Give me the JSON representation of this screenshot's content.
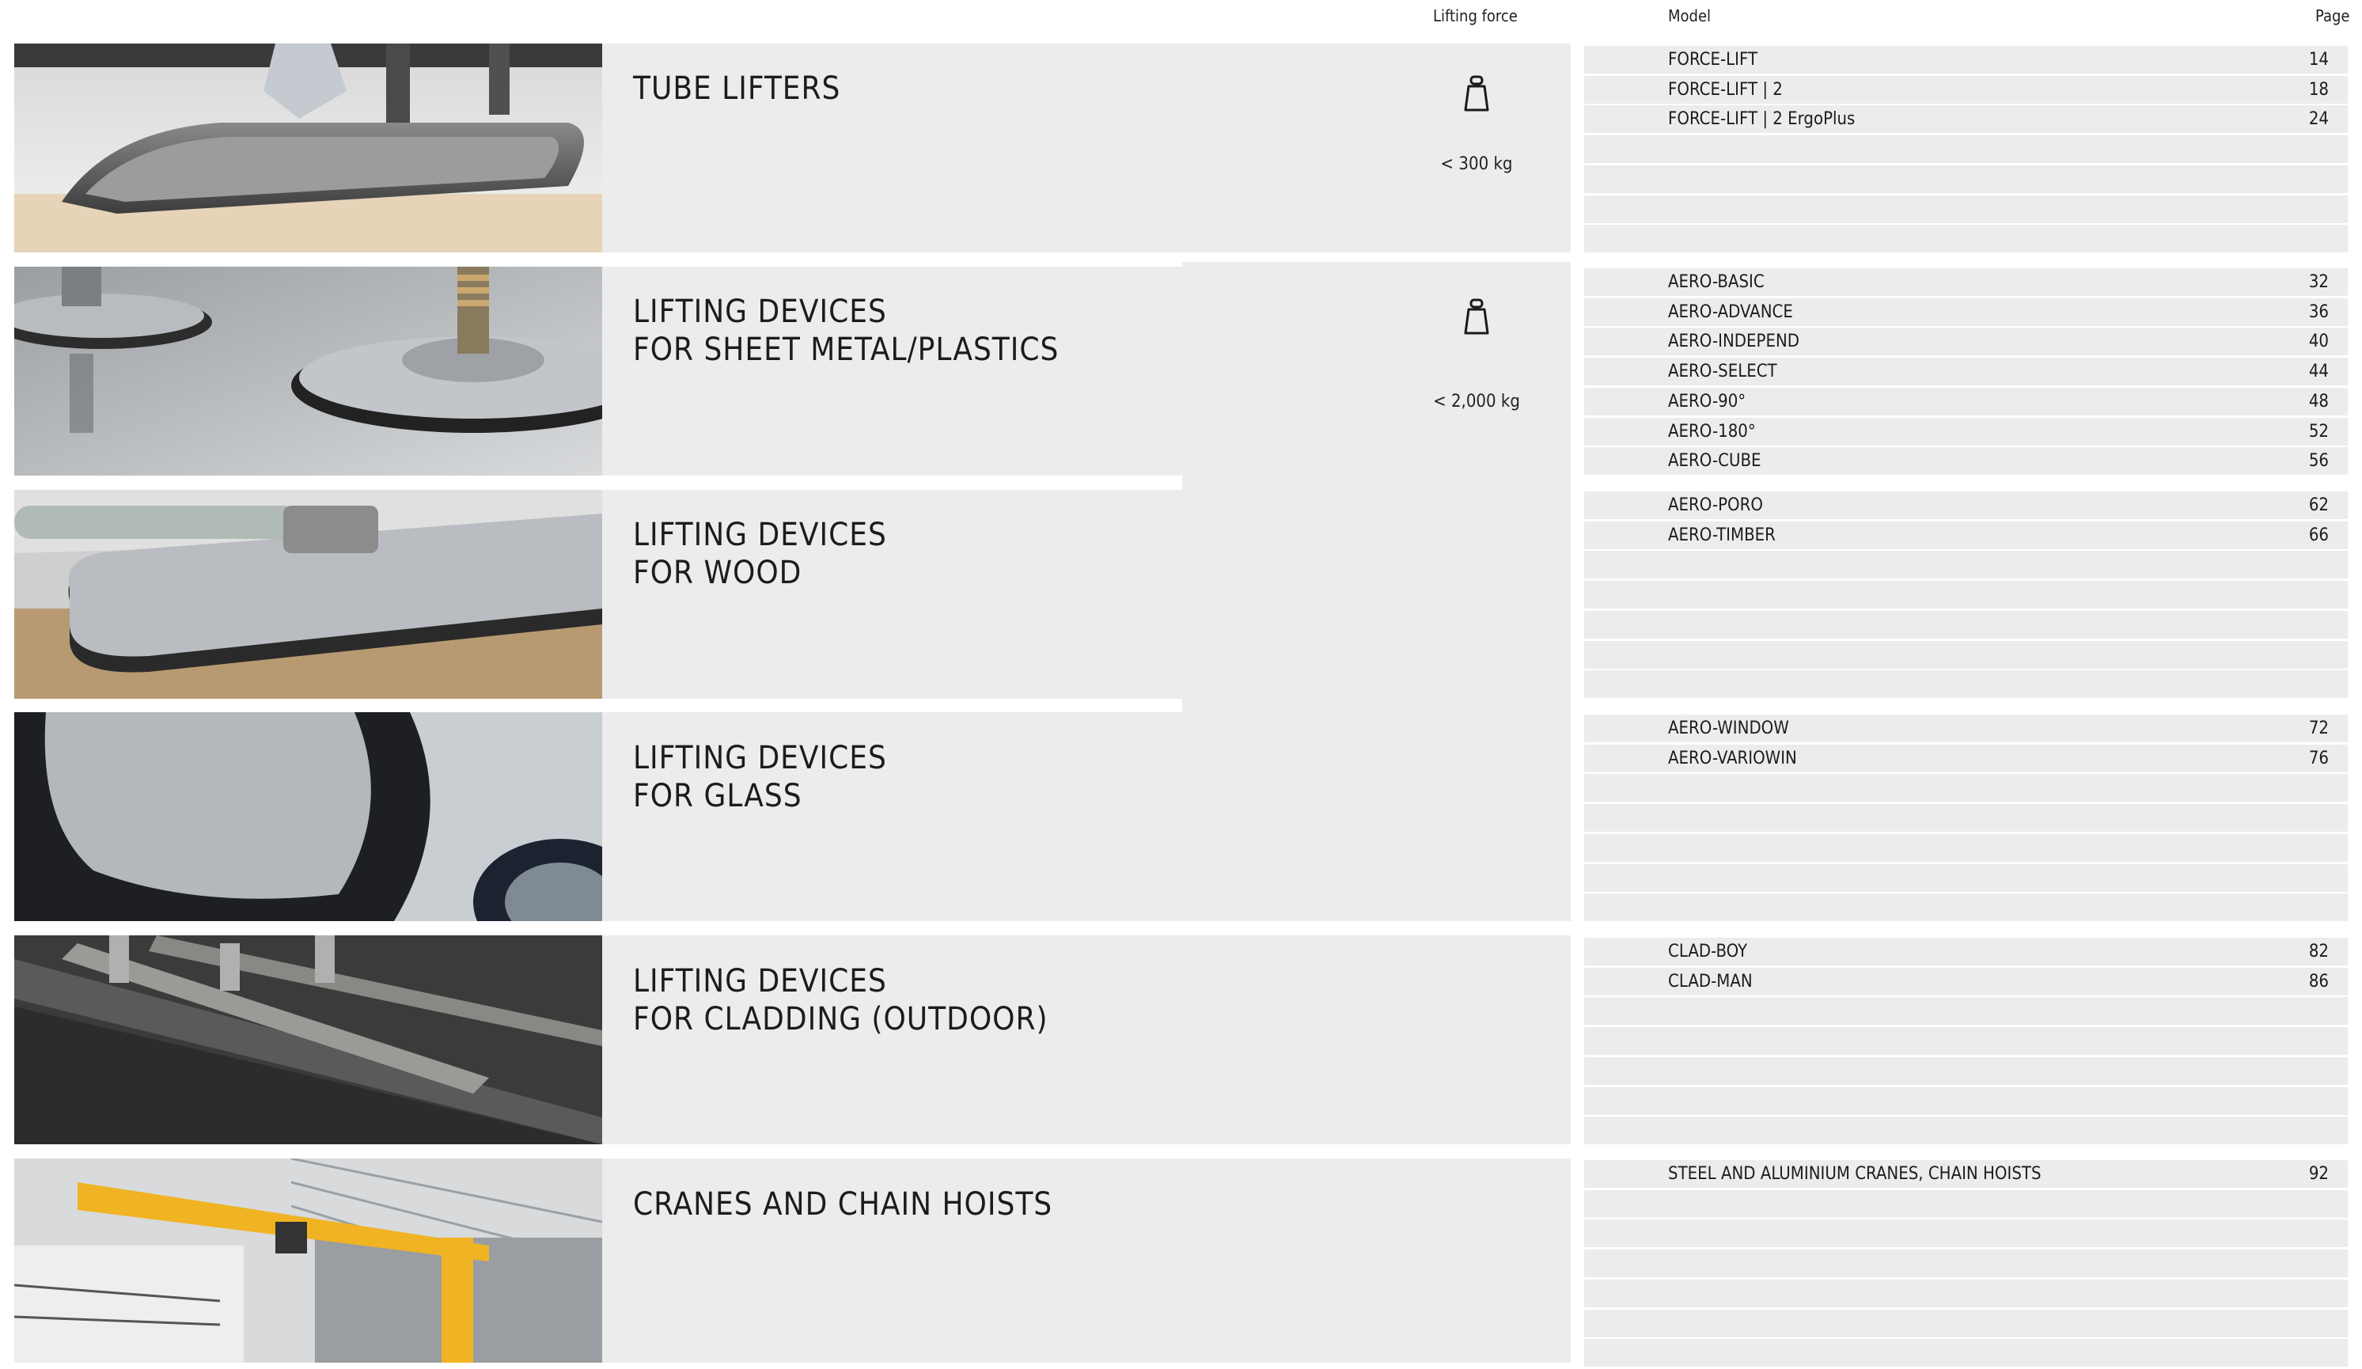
{
  "header": {
    "lifting_force": "Lifting force",
    "model": "Model",
    "page": "Page"
  },
  "sections": [
    {
      "title": [
        "TUBE LIFTERS"
      ],
      "force": "< 300 kg",
      "items": [
        {
          "model": "FORCE-LIFT",
          "page": "14"
        },
        {
          "model": "FORCE-LIFT | 2",
          "page": "18"
        },
        {
          "model": "FORCE-LIFT | 2 ErgoPlus",
          "page": "24"
        }
      ]
    },
    {
      "title": [
        "LIFTING DEVICES",
        "FOR SHEET METAL/PLASTICS"
      ],
      "force": "< 2,000 kg",
      "items": [
        {
          "model": "AERO-BASIC",
          "page": "32"
        },
        {
          "model": "AERO-ADVANCE",
          "page": "36"
        },
        {
          "model": "AERO-INDEPEND",
          "page": "40"
        },
        {
          "model": "AERO-SELECT",
          "page": "44"
        },
        {
          "model": "AERO-90°",
          "page": "48"
        },
        {
          "model": "AERO-180°",
          "page": "52"
        },
        {
          "model": "AERO-CUBE",
          "page": "56"
        }
      ]
    },
    {
      "title": [
        "LIFTING DEVICES",
        "FOR WOOD"
      ],
      "items": [
        {
          "model": "AERO-PORO",
          "page": "62"
        },
        {
          "model": "AERO-TIMBER",
          "page": "66"
        }
      ]
    },
    {
      "title": [
        "LIFTING DEVICES",
        "FOR GLASS"
      ],
      "items": [
        {
          "model": "AERO-WINDOW",
          "page": "72"
        },
        {
          "model": "AERO-VARIOWIN",
          "page": "76"
        }
      ]
    },
    {
      "title": [
        "LIFTING DEVICES",
        "FOR CLADDING (OUTDOOR)"
      ],
      "items": [
        {
          "model": "CLAD-BOY",
          "page": "82"
        },
        {
          "model": "CLAD-MAN",
          "page": "86"
        }
      ]
    },
    {
      "title": [
        "CRANES AND CHAIN HOISTS"
      ],
      "items": [
        {
          "model": "STEEL AND ALUMINIUM CRANES, CHAIN HOISTS",
          "page": "92"
        }
      ]
    }
  ],
  "icons": [
    "weight-icon"
  ],
  "colors": {
    "band": "#ececec",
    "crane": "#f0b323"
  }
}
